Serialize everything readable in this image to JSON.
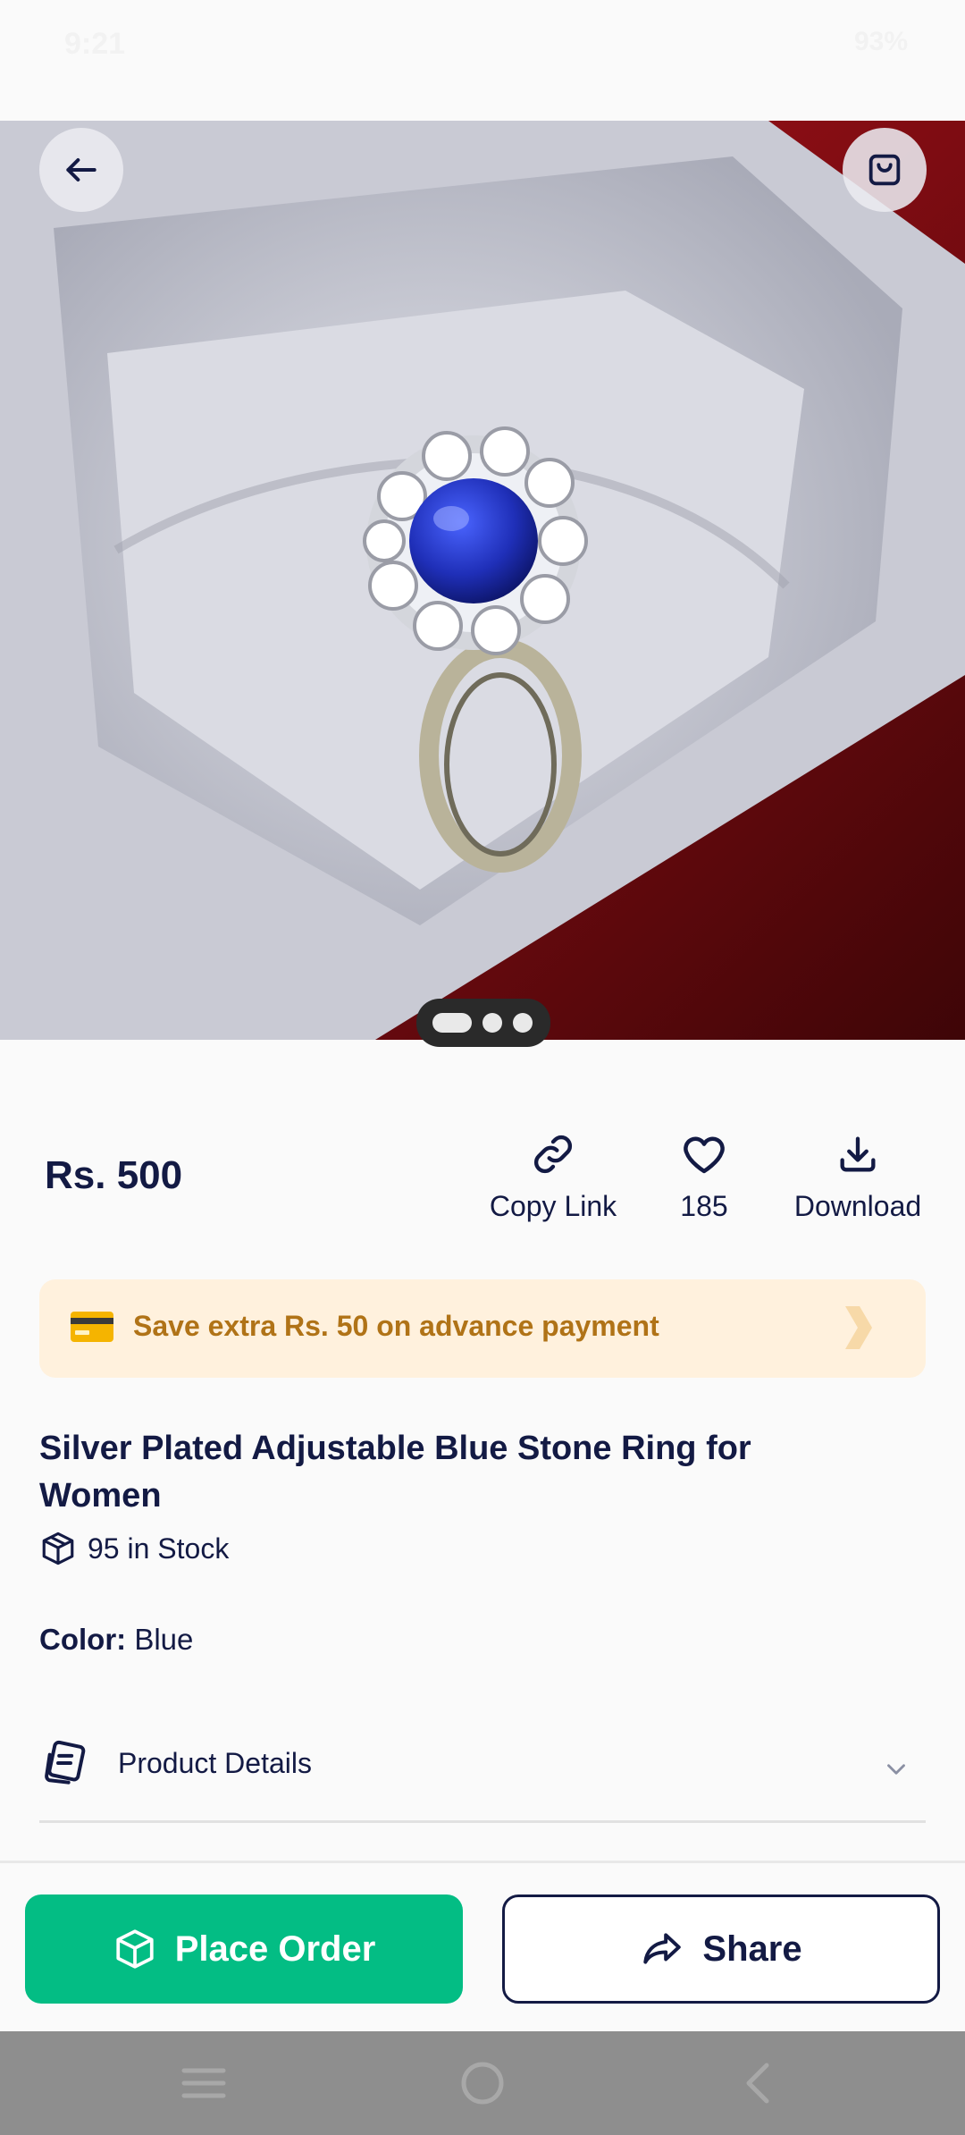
{
  "status_bar": {
    "time": "9:21",
    "battery": "93%"
  },
  "product": {
    "price": "Rs. 500",
    "title": "Silver Plated Adjustable Blue Stone Ring for Women",
    "stock": "95 in Stock",
    "color_label": "Color:",
    "color_value": "Blue",
    "image_count": 3,
    "active_image_index": 0
  },
  "actions": {
    "copy_link": "Copy Link",
    "likes": "185",
    "download": "Download"
  },
  "promo": {
    "text": "Save extra Rs. 50 on advance payment"
  },
  "details": {
    "label": "Product Details"
  },
  "buttons": {
    "place_order": "Place Order",
    "share": "Share"
  },
  "icons": {
    "back": "arrow-left-icon",
    "cart": "shopping-bag-icon",
    "copy_link": "link-icon",
    "like": "heart-icon",
    "download": "download-icon",
    "promo": "credit-card-icon",
    "stock": "box-icon",
    "details": "document-icon",
    "expand": "chevron-down-icon",
    "order": "box-icon",
    "share": "share-arrow-icon"
  },
  "colors": {
    "primary_text": "#131a44",
    "accent_green": "#03bd84",
    "promo_bg": "#fff1dd",
    "promo_text": "#b07317"
  }
}
